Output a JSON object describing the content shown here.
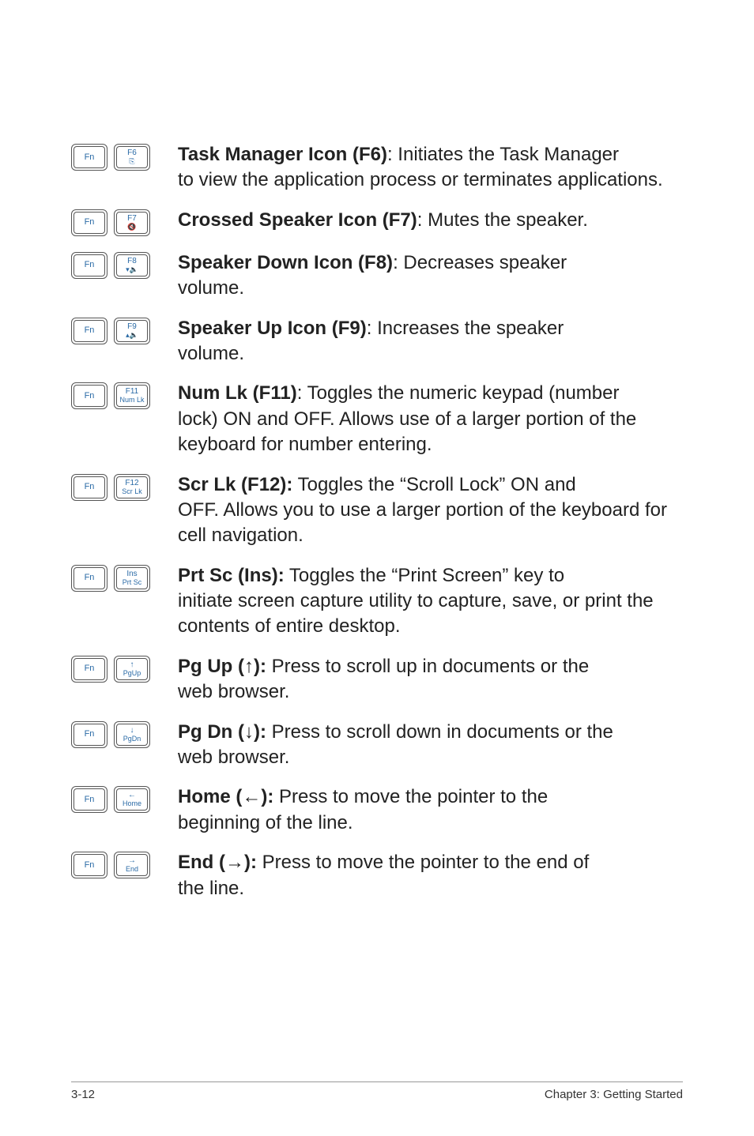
{
  "rows": [
    {
      "key1": "Fn",
      "key2top": "F6",
      "key2bot": "⎘",
      "lead": "Task Manager Icon (F6)",
      "sep": ": ",
      "rest_first": "Initiates the Task Manager",
      "rest_more": "to view the application process or terminates applications.",
      "icon1": "fn",
      "icon2": "f6"
    },
    {
      "key1": "Fn",
      "key2top": "F7",
      "key2bot": "🔇",
      "lead": "Crossed Speaker Icon (F7)",
      "sep": ": ",
      "rest_first": "Mutes the speaker.",
      "rest_more": "",
      "icon1": "fn",
      "icon2": "f7"
    },
    {
      "key1": "Fn",
      "key2top": "F8",
      "key2bot": "▾🔈",
      "lead": "Speaker Down Icon (F8)",
      "sep": ": ",
      "rest_first": "Decreases speaker",
      "rest_more": "volume.",
      "icon1": "fn",
      "icon2": "f8"
    },
    {
      "key1": "Fn",
      "key2top": "F9",
      "key2bot": "▴🔈",
      "lead": "Speaker Up Icon (F9)",
      "sep": ": ",
      "rest_first": "Increases the speaker",
      "rest_more": "volume.",
      "icon1": "fn",
      "icon2": "f9"
    },
    {
      "key1": "Fn",
      "key2top": "F11",
      "key2bot": "Num Lk",
      "lead": "Num Lk (F11)",
      "sep": ": ",
      "rest_first": "Toggles the numeric keypad (number",
      "rest_more": "lock) ON and OFF. Allows use of a larger portion of the keyboard for number entering.",
      "icon1": "fn",
      "icon2": "f11"
    },
    {
      "key1": "Fn",
      "key2top": "F12",
      "key2bot": "Scr Lk",
      "lead": "Scr Lk (F12):",
      "sep": " ",
      "rest_first": "Toggles the “Scroll Lock” ON and",
      "rest_more": "OFF. Allows you to use a larger portion of the keyboard for cell navigation.",
      "icon1": "fn",
      "icon2": "f12"
    },
    {
      "key1": "Fn",
      "key2top": "Ins",
      "key2bot": "Prt Sc",
      "lead": "Prt Sc (Ins):",
      "sep": " ",
      "rest_first": "Toggles the “Print Screen” key to",
      "rest_more": "initiate screen capture utility to capture, save, or print the contents of entire desktop.",
      "icon1": "fn",
      "icon2": "ins"
    },
    {
      "key1": "Fn",
      "key2top": "↑",
      "key2bot": "PgUp",
      "lead": "Pg Up (↑):",
      "sep": " ",
      "rest_first": "Press to scroll up in documents or the",
      "rest_more": "web browser.",
      "icon1": "fn",
      "icon2": "pgup"
    },
    {
      "key1": "Fn",
      "key2top": "↓",
      "key2bot": "PgDn",
      "lead": "Pg Dn (↓):",
      "sep": " ",
      "rest_first": "Press to scroll down in documents or the",
      "rest_more": "web browser.",
      "icon1": "fn",
      "icon2": "pgdn"
    },
    {
      "key1": "Fn",
      "key2top": "←",
      "key2bot": "Home",
      "lead": "Home (←):",
      "sep": " ",
      "rest_first": "Press to move the pointer to the",
      "rest_more": "beginning of the line.",
      "icon1": "fn",
      "icon2": "home"
    },
    {
      "key1": "Fn",
      "key2top": "→",
      "key2bot": "End",
      "lead": "End (→):",
      "sep": " ",
      "rest_first": "Press to move the pointer to the end of",
      "rest_more": "the line.",
      "icon1": "fn",
      "icon2": "end"
    }
  ],
  "footer": {
    "page": "3-12",
    "chapter": "Chapter 3: Getting Started"
  }
}
